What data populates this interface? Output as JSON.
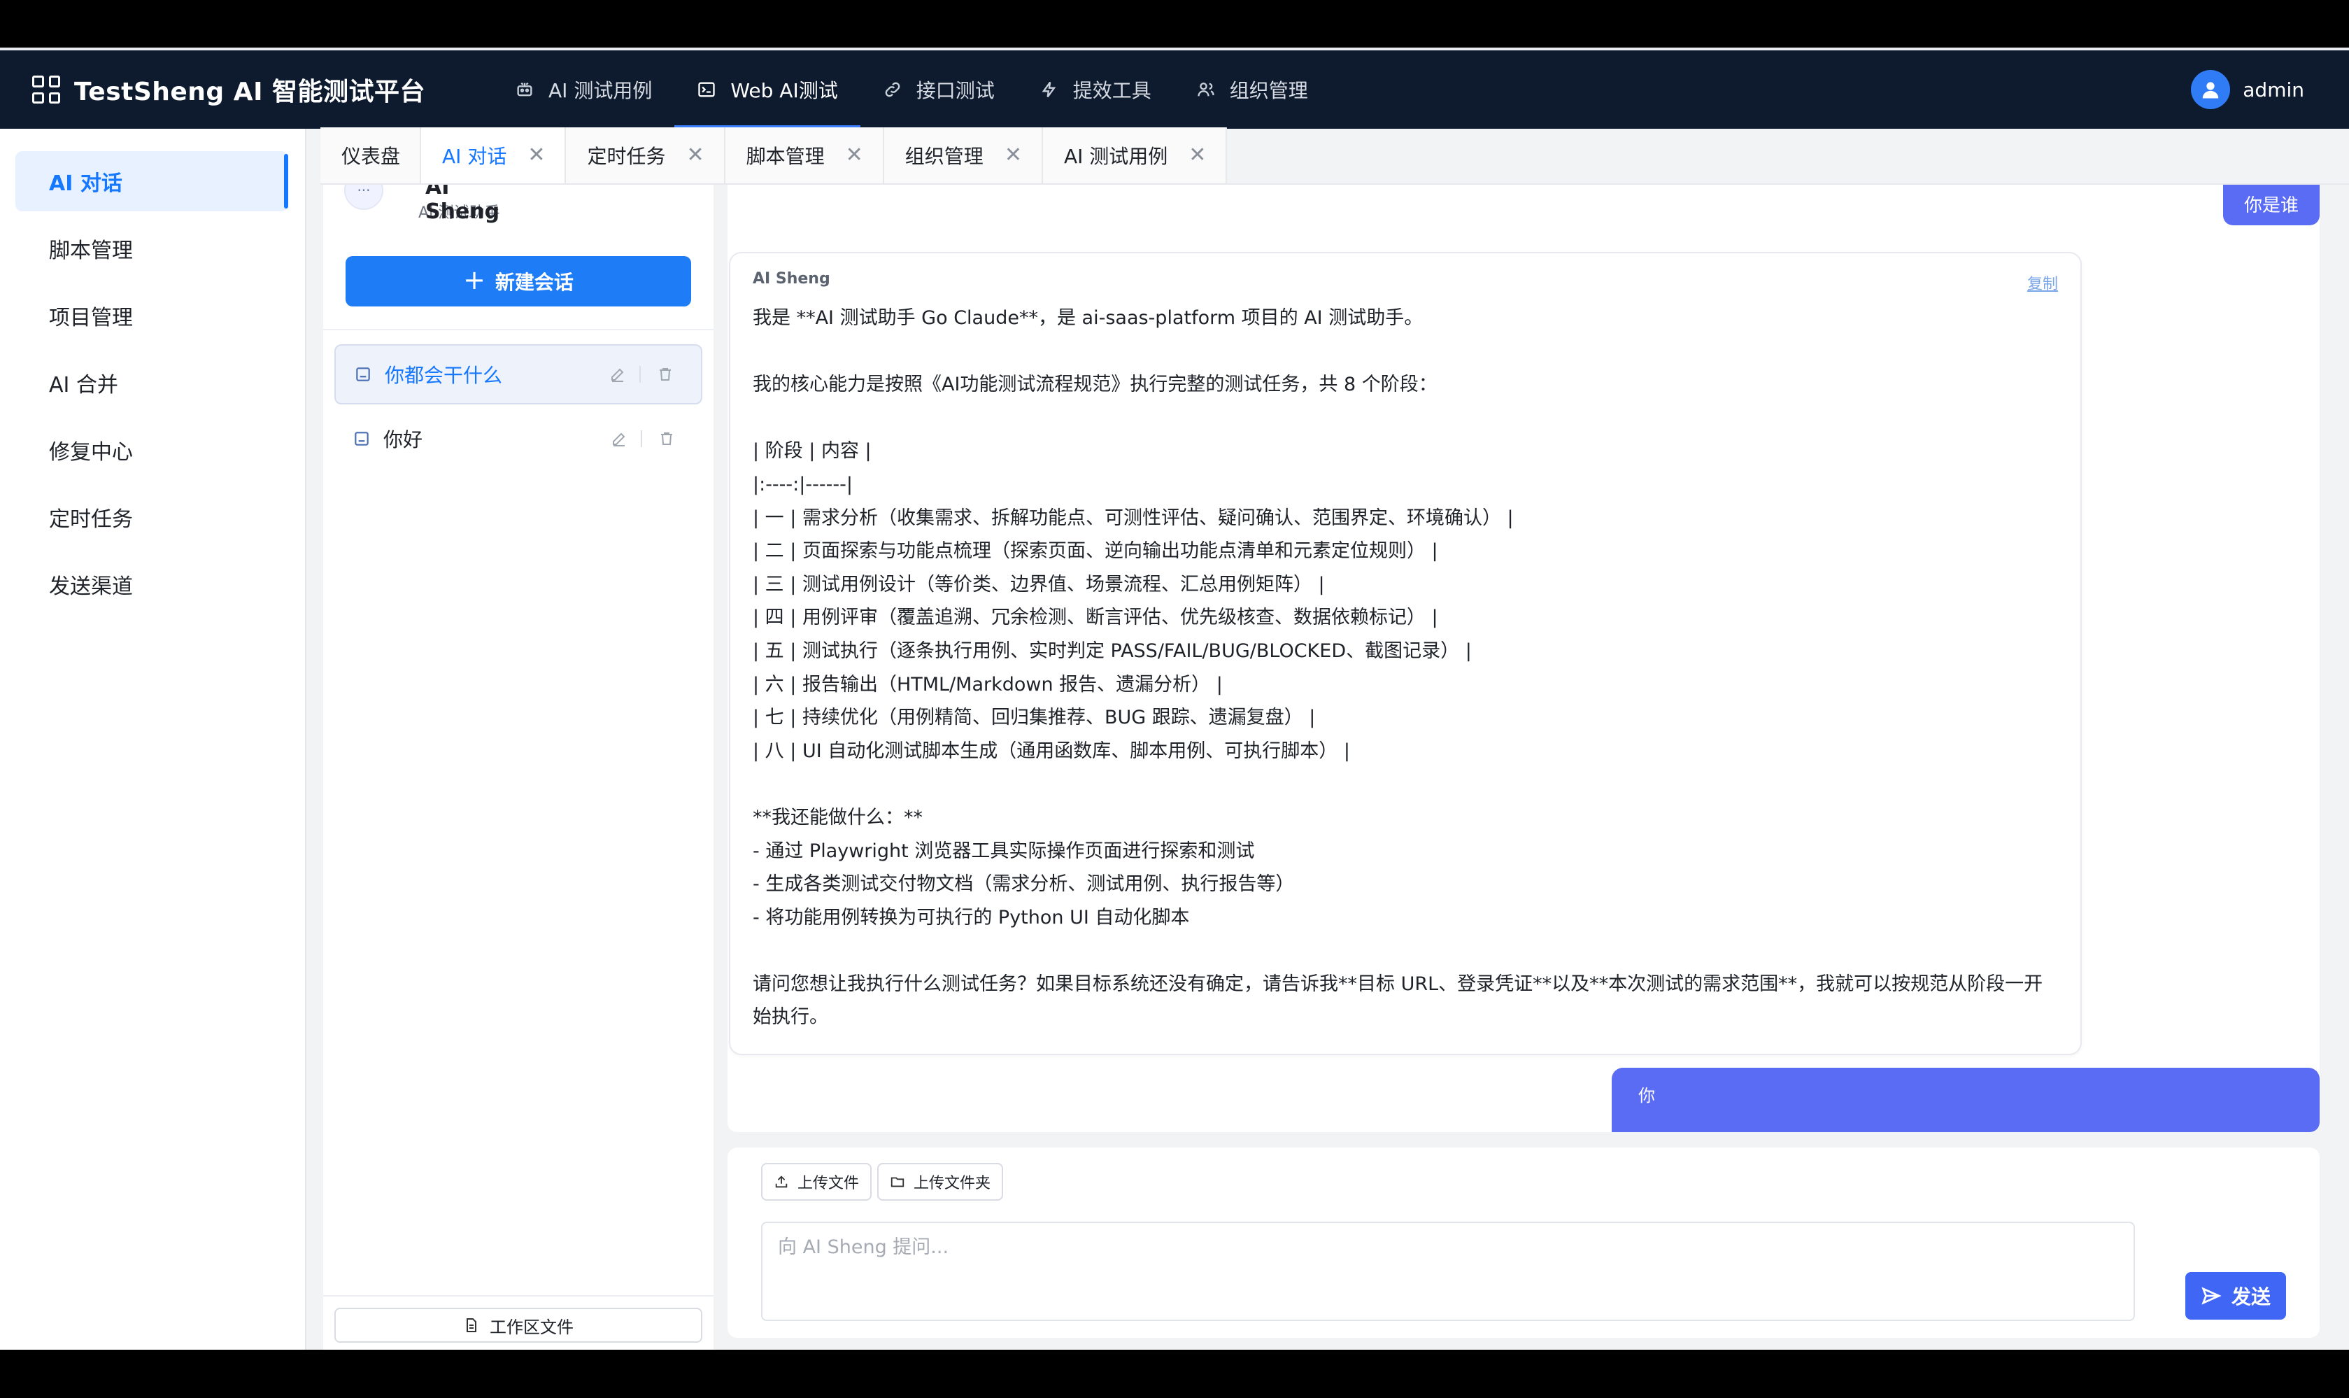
{
  "header": {
    "brand": "TestSheng AI 智能测试平台",
    "nav": [
      {
        "label": "AI 测试用例",
        "icon": "robot-icon"
      },
      {
        "label": "Web AI测试",
        "icon": "terminal-icon",
        "active": true
      },
      {
        "label": "接口测试",
        "icon": "link-icon"
      },
      {
        "label": "提效工具",
        "icon": "lightning-icon"
      },
      {
        "label": "组织管理",
        "icon": "team-icon"
      }
    ],
    "username": "admin"
  },
  "sidebar": {
    "items": [
      {
        "label": "AI 对话",
        "active": true
      },
      {
        "label": "脚本管理"
      },
      {
        "label": "项目管理"
      },
      {
        "label": "AI 合并"
      },
      {
        "label": "修复中心"
      },
      {
        "label": "定时任务"
      },
      {
        "label": "发送渠道"
      }
    ]
  },
  "tabs": [
    {
      "label": "仪表盘",
      "closable": false
    },
    {
      "label": "AI 对话",
      "closable": true,
      "active": true
    },
    {
      "label": "定时任务",
      "closable": true
    },
    {
      "label": "脚本管理",
      "closable": true
    },
    {
      "label": "组织管理",
      "closable": true
    },
    {
      "label": "AI 测试用例",
      "closable": true
    }
  ],
  "tab_close_glyph": "✕",
  "conversations": {
    "assistant_name": "AI Sheng",
    "assistant_subtitle": "AI 测试助手",
    "new_chat_label": "新建会话",
    "items": [
      {
        "title": "你都会干什么",
        "active": true
      },
      {
        "title": "你好"
      }
    ],
    "workspace_label": "工作区文件"
  },
  "chat": {
    "user_message_top": "你是谁",
    "ai_name": "AI Sheng",
    "copy_label": "复制",
    "ai_message": "我是 **AI 测试助手 Go Claude**，是 ai-saas-platform 项目的 AI 测试助手。\n\n我的核心能力是按照《AI功能测试流程规范》执行完整的测试任务，共 8 个阶段：\n\n| 阶段 | 内容 |\n|:----:|------|\n| 一 | 需求分析（收集需求、拆解功能点、可测性评估、疑问确认、范围界定、环境确认） |\n| 二 | 页面探索与功能点梳理（探索页面、逆向输出功能点清单和元素定位规则） |\n| 三 | 测试用例设计（等价类、边界值、场景流程、汇总用例矩阵） |\n| 四 | 用例评审（覆盖追溯、冗余检测、断言评估、优先级核查、数据依赖标记） |\n| 五 | 测试执行（逐条执行用例、实时判定 PASS/FAIL/BUG/BLOCKED、截图记录） |\n| 六 | 报告输出（HTML/Markdown 报告、遗漏分析） |\n| 七 | 持续优化（用例精简、回归集推荐、BUG 跟踪、遗漏复盘） |\n| 八 | UI 自动化测试脚本生成（通用函数库、脚本用例、可执行脚本） |\n\n**我还能做什么：**\n- 通过 Playwright 浏览器工具实际操作页面进行探索和测试\n- 生成各类测试交付物文档（需求分析、测试用例、执行报告等）\n- 将功能用例转换为可执行的 Python UI 自动化脚本\n\n请问您想让我执行什么测试任务？如果目标系统还没有确定，请告诉我**目标 URL、登录凭证**以及**本次测试的需求范围**，我就可以按规范从阶段一开始执行。",
    "user_message_bottom": "你"
  },
  "composer": {
    "upload_file_label": "上传文件",
    "upload_folder_label": "上传文件夹",
    "placeholder": "向 AI Sheng 提问...",
    "send_label": "发送"
  },
  "colors": {
    "header_bg": "#0e1b2e",
    "accent": "#1677ff",
    "user_bubble": "#5b6cf4",
    "send_button": "#4066f5"
  }
}
